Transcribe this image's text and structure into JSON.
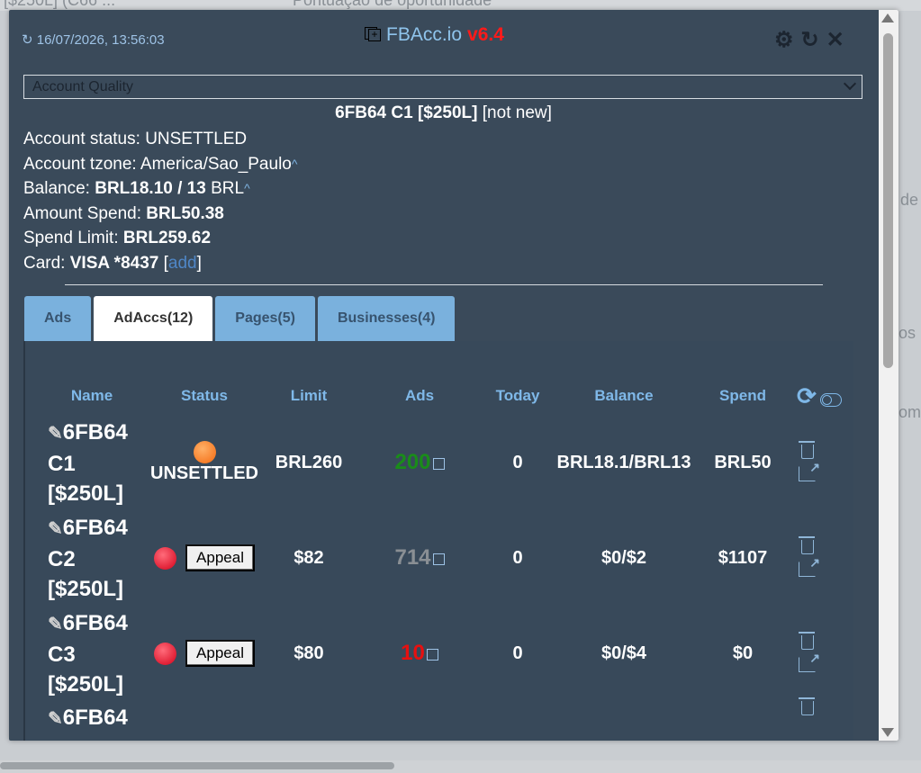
{
  "header": {
    "timestamp": "16/07/2026, 13:56:03",
    "refresh_glyph": "↻",
    "brand_name": "FBAcc.io",
    "brand_version": "v6.4",
    "tools": {
      "settings": "⚙",
      "refresh": "↻",
      "close": "✕"
    }
  },
  "selector": {
    "value": "Account Quality"
  },
  "account": {
    "title_bold": "6FB64 C1 [$250L]",
    "title_suffix": "[not new]",
    "status_label": "Account status: ",
    "status_value": "UNSETTLED",
    "tzone_label": "Account tzone: ",
    "tzone_value": "America/Sao_Paulo",
    "balance_label": "Balance: ",
    "balance_value": "BRL18.10 / 13",
    "balance_suffix": " BRL",
    "spend_label": "Amount Spend: ",
    "spend_value": "BRL50.38",
    "limit_label": "Spend Limit: ",
    "limit_value": "BRL259.62",
    "card_label": "Card: ",
    "card_value": "VISA *8437",
    "card_add": "add",
    "caret": "^"
  },
  "tabs": [
    "Ads",
    "AdAccs(12)",
    "Pages(5)",
    "Businesses(4)"
  ],
  "table": {
    "headers": [
      "Name",
      "Status",
      "Limit",
      "Ads",
      "Today",
      "Balance",
      "Spend"
    ],
    "appeal_label": "Appeal",
    "rows": [
      {
        "name_l1": "6FB64",
        "name_l2": "C1",
        "name_l3": "[$250L]",
        "status": "UNSETTLED",
        "dot": "orange",
        "limit": "BRL260",
        "ads": "200",
        "ads_color": "green",
        "today": "0",
        "balance": "BRL18.1/BRL13",
        "spend": "BRL50"
      },
      {
        "name_l1": "6FB64",
        "name_l2": "C2",
        "name_l3": "[$250L]",
        "status": "",
        "dot": "red",
        "limit": "$82",
        "ads": "714",
        "ads_color": "gray",
        "today": "0",
        "balance": "$0/$2",
        "spend": "$1107"
      },
      {
        "name_l1": "6FB64",
        "name_l2": "C3",
        "name_l3": "[$250L]",
        "status": "",
        "dot": "red",
        "limit": "$80",
        "ads": "10",
        "ads_color": "red",
        "today": "0",
        "balance": "$0/$4",
        "spend": "$0"
      },
      {
        "name_l1": "6FB64",
        "name_l2": "",
        "name_l3": ""
      }
    ]
  },
  "background": {
    "frag_top": "[$250L] (C66 ...",
    "frag_top2": "Pontuação de oportunidade",
    "frag_right1": "de",
    "frag_right2": "os",
    "frag_right3": "omp"
  }
}
